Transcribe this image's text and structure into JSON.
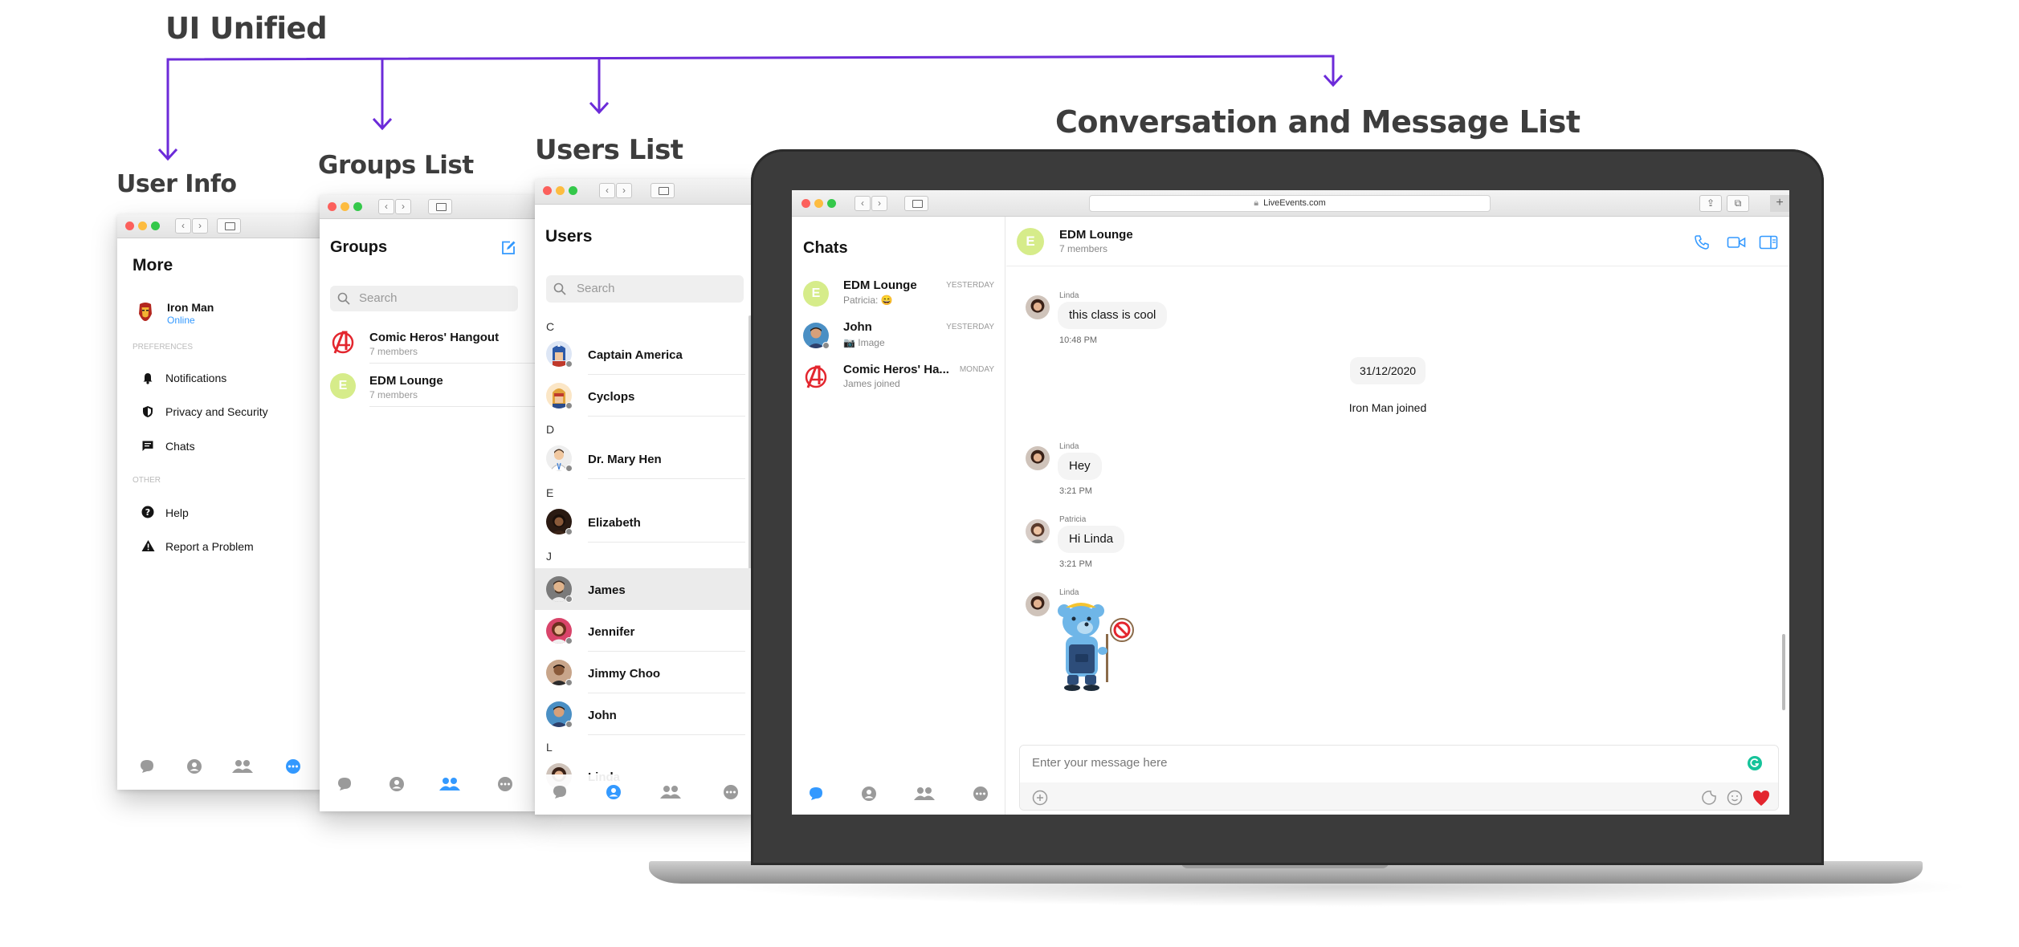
{
  "headings": {
    "ui_unified": "UI Unified",
    "user_info": "User Info",
    "groups_list": "Groups List",
    "users_list": "Users List",
    "conversation": "Conversation and Message List"
  },
  "more_panel": {
    "title": "More",
    "profile": {
      "name": "Iron Man",
      "status": "Online"
    },
    "preferences_label": "PREFERENCES",
    "preferences": [
      "Notifications",
      "Privacy and Security",
      "Chats"
    ],
    "other_label": "OTHER",
    "other": [
      "Help",
      "Report a Problem"
    ]
  },
  "groups_panel": {
    "title": "Groups",
    "search_placeholder": "Search",
    "groups": [
      {
        "name": "Comic Heros' Hangout",
        "members": "7 members"
      },
      {
        "name": "EDM Lounge",
        "members": "7 members",
        "initial": "E"
      }
    ]
  },
  "users_panel": {
    "title": "Users",
    "search_placeholder": "Search",
    "sections": [
      {
        "letter": "C",
        "users": [
          "Captain America",
          "Cyclops"
        ]
      },
      {
        "letter": "D",
        "users": [
          "Dr. Mary Hen"
        ]
      },
      {
        "letter": "E",
        "users": [
          "Elizabeth"
        ]
      },
      {
        "letter": "J",
        "users": [
          "James",
          "Jennifer",
          "Jimmy Choo",
          "John"
        ]
      },
      {
        "letter": "L",
        "users": [
          "Linda"
        ]
      }
    ],
    "selected": "James"
  },
  "browser": {
    "url": "LiveEvents.com"
  },
  "chats_panel": {
    "title": "Chats",
    "chats": [
      {
        "name": "EDM Lounge",
        "preview": "Patricia: 😄",
        "time": "YESTERDAY",
        "initial": "E"
      },
      {
        "name": "John",
        "preview": "📷 Image",
        "time": "YESTERDAY"
      },
      {
        "name": "Comic Heros' Ha...",
        "preview": "James joined",
        "time": "MONDAY"
      }
    ]
  },
  "conversation": {
    "group_name": "EDM Lounge",
    "group_initial": "E",
    "members": "7 members",
    "messages": [
      {
        "sender": "Linda",
        "text": "this class is cool",
        "time": "10:48 PM"
      },
      {
        "date": "31/12/2020"
      },
      {
        "system": "Iron Man joined"
      },
      {
        "sender": "Linda",
        "text": "Hey",
        "time": "3:21 PM"
      },
      {
        "sender": "Patricia",
        "text": "Hi Linda",
        "time": "3:21 PM"
      },
      {
        "sender": "Linda",
        "sticker": "bear-sticker"
      }
    ],
    "composer_placeholder": "Enter your message here"
  },
  "colors": {
    "accent_purple": "#6c2bd9",
    "primary_blue": "#3399ff",
    "edm_green": "#d6ec8a",
    "heart_red": "#e3262e",
    "laptop_bezel": "#3b3b3b"
  }
}
